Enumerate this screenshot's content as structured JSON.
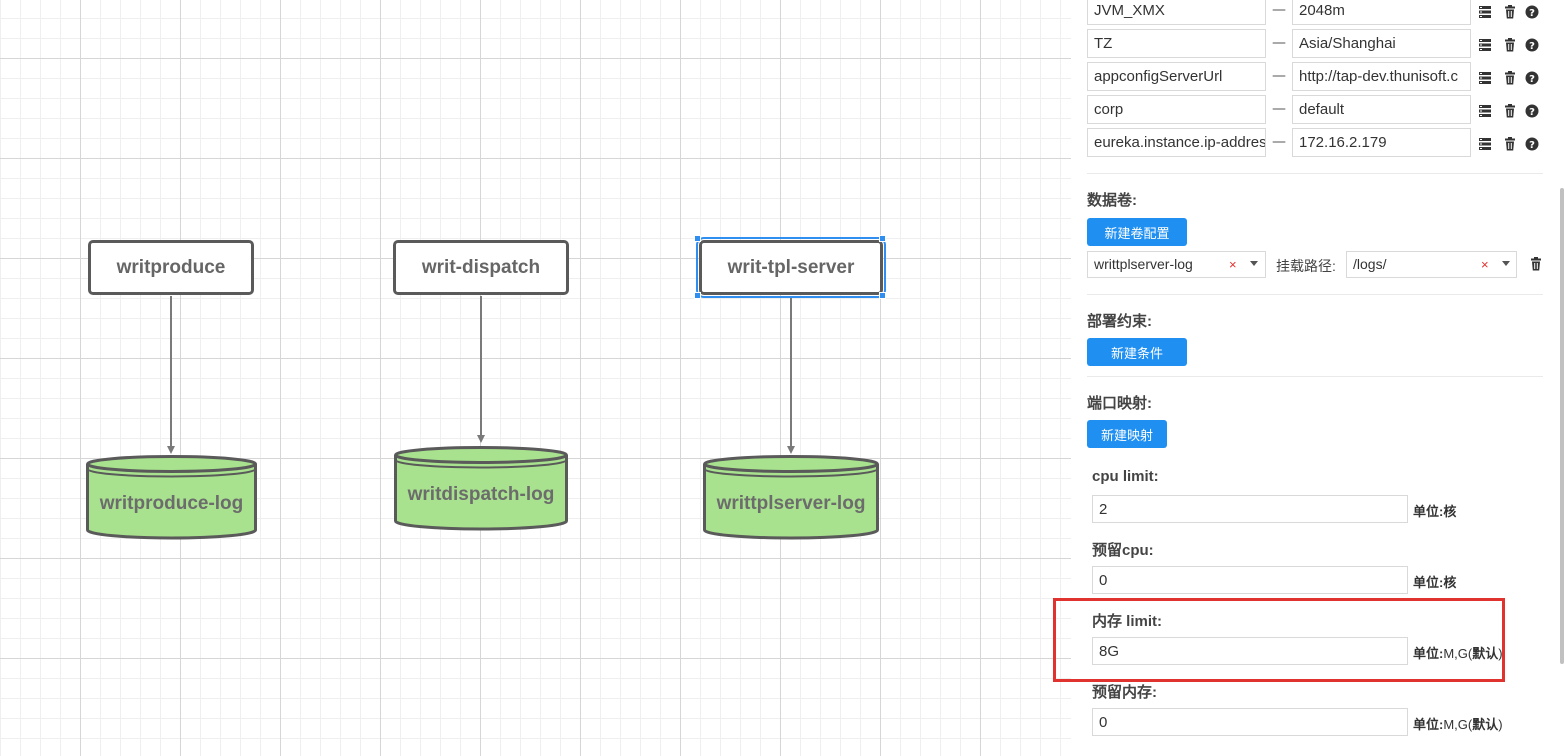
{
  "canvas": {
    "services": [
      {
        "name": "writproduce"
      },
      {
        "name": "writ-dispatch"
      },
      {
        "name": "writ-tpl-server"
      }
    ],
    "volumes": [
      {
        "name": "writproduce-log"
      },
      {
        "name": "writdispatch-log"
      },
      {
        "name": "writtplserver-log"
      }
    ],
    "selected_service": "writ-tpl-server",
    "volume_fill": "#a8e28e",
    "stroke_color": "#5a5a5a",
    "selection_color": "#2f8ef0"
  },
  "panel": {
    "env_vars": [
      {
        "key": "JVM_XMX",
        "value": "2048m"
      },
      {
        "key": "TZ",
        "value": "Asia/Shanghai"
      },
      {
        "key": "appconfigServerUrl",
        "value": "http://tap-dev.thunisoft.c"
      },
      {
        "key": "corp",
        "value": "default"
      },
      {
        "key": "eureka.instance.ip-addres",
        "value": "172.16.2.179"
      }
    ],
    "separator": "—",
    "row_icons": [
      "list-icon",
      "trash-icon",
      "help-icon"
    ],
    "volumes_section": {
      "title": "数据卷:",
      "add_button": "新建卷配置",
      "volume_select": "writtplserver-log",
      "clear_mark": "×",
      "mount_label": "挂载路径:",
      "mount_select": "/logs/"
    },
    "constraints_section": {
      "title": "部署约束:",
      "add_button": "新建条件"
    },
    "ports_section": {
      "title": "端口映射:",
      "add_button": "新建映射"
    },
    "cpu_limit": {
      "label": "cpu limit:",
      "value": "2",
      "unit_label": "单位:",
      "unit": "核"
    },
    "cpu_reserve": {
      "label": "预留cpu:",
      "value": "0",
      "unit_label": "单位:",
      "unit": "核"
    },
    "mem_limit": {
      "label": "内存 limit:",
      "value": "8G",
      "unit_label": "单位:",
      "unit_pre": "M,G(",
      "unit_default": "默认",
      "unit_post": ")"
    },
    "mem_reserve": {
      "label": "预留内存:",
      "value": "0",
      "unit_label": "单位:",
      "unit_pre": "M,G(",
      "unit_default": "默认",
      "unit_post": ")"
    },
    "accent_color": "#1f8ff2",
    "highlight_color": "#e0332f"
  }
}
